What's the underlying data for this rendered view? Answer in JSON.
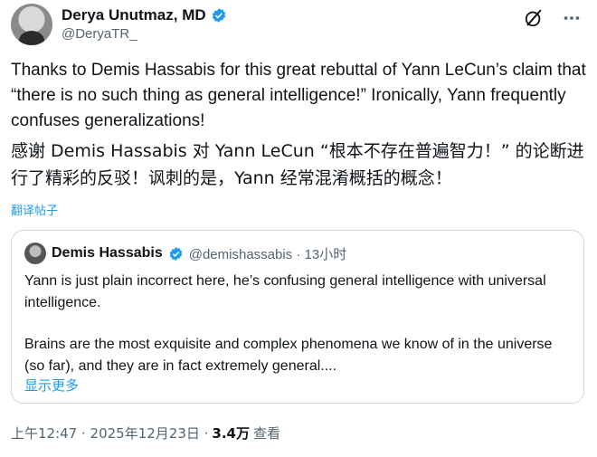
{
  "author": {
    "display_name": "Derya Unutmaz, MD",
    "handle": "@DeryaTR_",
    "avatar_icon": "avatar",
    "verified_icon": "verified-badge-icon"
  },
  "header_actions": {
    "grok_icon": "slash-circle-icon",
    "more_icon": "more-dots-icon"
  },
  "tweet": {
    "text_en": "Thanks to Demis Hassabis for this great rebuttal of Yann LeCun’s claim that “there is no such thing as general intelligence!” Ironically, Yann frequently confuses generalizations!",
    "text_cn": "感谢 Demis Hassabis 对 Yann LeCun “根本不存在普遍智力！” 的论断进行了精彩的反驳！讽刺的是，Yann 经常混淆概括的概念！",
    "translate_label": "翻译帖子"
  },
  "quoted": {
    "display_name": "Demis Hassabis",
    "handle_time": "@demishassabis · 13小时",
    "paragraph1": "Yann is just plain incorrect here, he’s confusing general intelligence with universal intelligence.",
    "paragraph2": "Brains are the most exquisite and complex phenomena we know of in the universe (so far), and they are in fact extremely general....",
    "show_more": "显示更多"
  },
  "meta": {
    "time_date": "上午12:47 · 2025年12月23日 ·",
    "views_count": "3.4万",
    "views_label": "查看"
  },
  "colors": {
    "accent": "#1d9bf0",
    "text": "#0f1419",
    "muted": "#536471",
    "border": "#cfd9de"
  }
}
